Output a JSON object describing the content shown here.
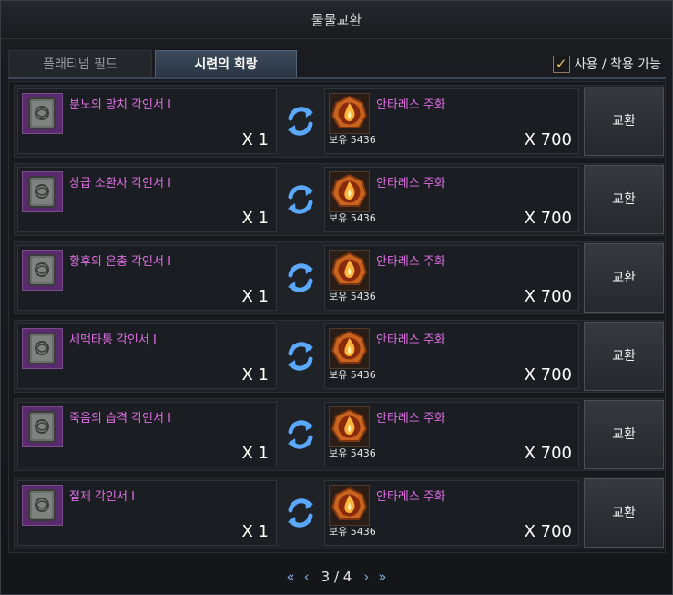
{
  "window": {
    "title": "물물교환"
  },
  "tabs": [
    {
      "label": "플래티넘 필드",
      "active": false
    },
    {
      "label": "시련의 회랑",
      "active": true
    }
  ],
  "filter": {
    "label": "사용 / 착용 가능",
    "checked": true
  },
  "rows": [
    {
      "item_name": "분노의 망치 각인서 I",
      "item_qty": "X 1",
      "cost_name": "안타레스 주화",
      "owned": "보유 5436",
      "cost_qty": "X 700",
      "button": "교환"
    },
    {
      "item_name": "상급 소환사 각인서 I",
      "item_qty": "X 1",
      "cost_name": "안타레스 주화",
      "owned": "보유 5436",
      "cost_qty": "X 700",
      "button": "교환"
    },
    {
      "item_name": "황후의 은총 각인서 I",
      "item_qty": "X 1",
      "cost_name": "안타레스 주화",
      "owned": "보유 5436",
      "cost_qty": "X 700",
      "button": "교환"
    },
    {
      "item_name": "세맥타통 각인서 I",
      "item_qty": "X 1",
      "cost_name": "안타레스 주화",
      "owned": "보유 5436",
      "cost_qty": "X 700",
      "button": "교환"
    },
    {
      "item_name": "죽음의 습격 각인서 I",
      "item_qty": "X 1",
      "cost_name": "안타레스 주화",
      "owned": "보유 5436",
      "cost_qty": "X 700",
      "button": "교환"
    },
    {
      "item_name": "절제 각인서 I",
      "item_qty": "X 1",
      "cost_name": "안타레스 주화",
      "owned": "보유 5436",
      "cost_qty": "X 700",
      "button": "교환"
    }
  ],
  "pager": {
    "first": "«",
    "prev": "‹",
    "text": "3 / 4",
    "next": "›",
    "last": "»"
  },
  "colors": {
    "item_name": "#e26ee6",
    "accent": "#7da9d8",
    "check": "#e8c060"
  },
  "icons": {
    "item": "engraving-book-icon",
    "cost": "antares-coin-icon",
    "swap": "exchange-arrows-icon"
  }
}
